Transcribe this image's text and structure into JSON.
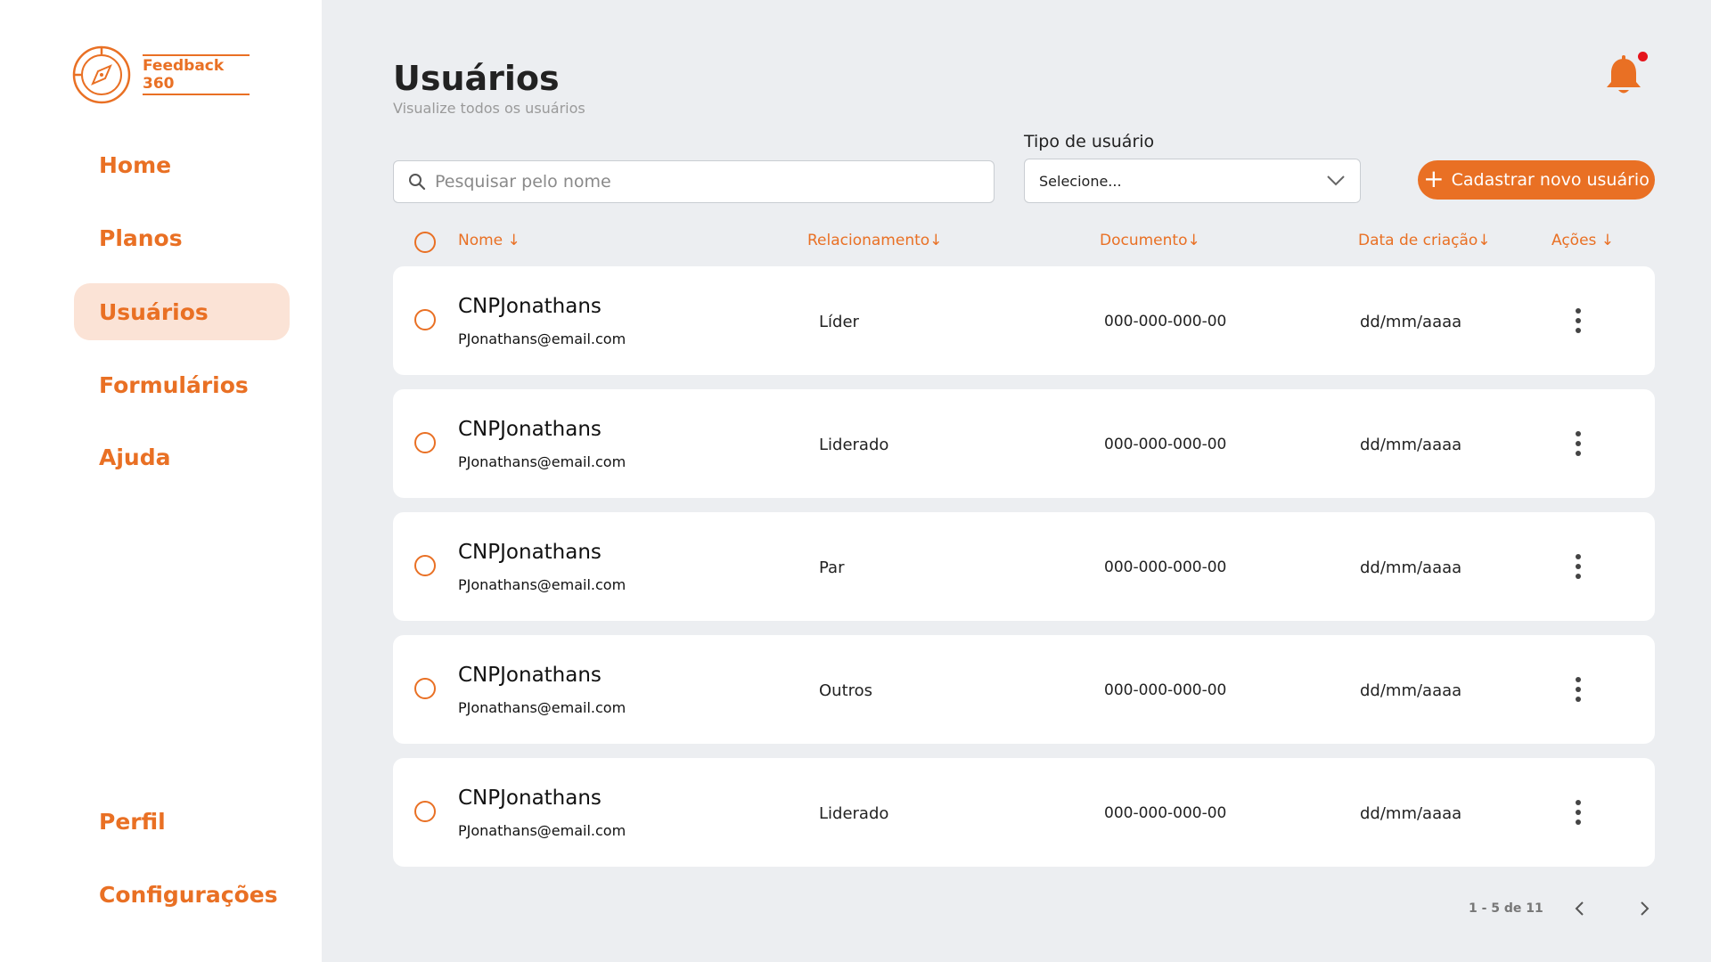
{
  "brand": {
    "name": "Feedback 360",
    "accent": "#E97024"
  },
  "sidebar": {
    "items": [
      {
        "label": "Home"
      },
      {
        "label": "Planos"
      },
      {
        "label": "Usuários"
      },
      {
        "label": "Formulários"
      },
      {
        "label": "Ajuda"
      }
    ],
    "bottom_items": [
      {
        "label": "Perfil"
      },
      {
        "label": "Configurações"
      }
    ],
    "active": "Usuários"
  },
  "header": {
    "title": "Usuários",
    "subtitle": "Visualize todos os usuários",
    "notification_icon": "bell-icon",
    "has_unread": true
  },
  "filters": {
    "search_placeholder": "Pesquisar pelo nome",
    "search_value": "",
    "type_label": "Tipo de usuário",
    "type_selected": "Selecione..."
  },
  "actions": {
    "add_user": "Cadastrar novo usuário"
  },
  "table": {
    "columns": [
      "Nome ↓",
      "Relacionamento↓",
      "Documento↓",
      "Data de criação↓",
      "Ações ↓"
    ],
    "rows": [
      {
        "name": "CNPJonathans",
        "email": "PJonathans@email.com",
        "relationship": "Líder",
        "document": "000-000-000-00",
        "created": "dd/mm/aaaa"
      },
      {
        "name": "CNPJonathans",
        "email": "PJonathans@email.com",
        "relationship": "Liderado",
        "document": "000-000-000-00",
        "created": "dd/mm/aaaa"
      },
      {
        "name": "CNPJonathans",
        "email": "PJonathans@email.com",
        "relationship": "Par",
        "document": "000-000-000-00",
        "created": "dd/mm/aaaa"
      },
      {
        "name": "CNPJonathans",
        "email": "PJonathans@email.com",
        "relationship": "Outros",
        "document": "000-000-000-00",
        "created": "dd/mm/aaaa"
      },
      {
        "name": "CNPJonathans",
        "email": "PJonathans@email.com",
        "relationship": "Liderado",
        "document": "000-000-000-00",
        "created": "dd/mm/aaaa"
      }
    ]
  },
  "pagination": {
    "label": "1 - 5 de 11"
  }
}
